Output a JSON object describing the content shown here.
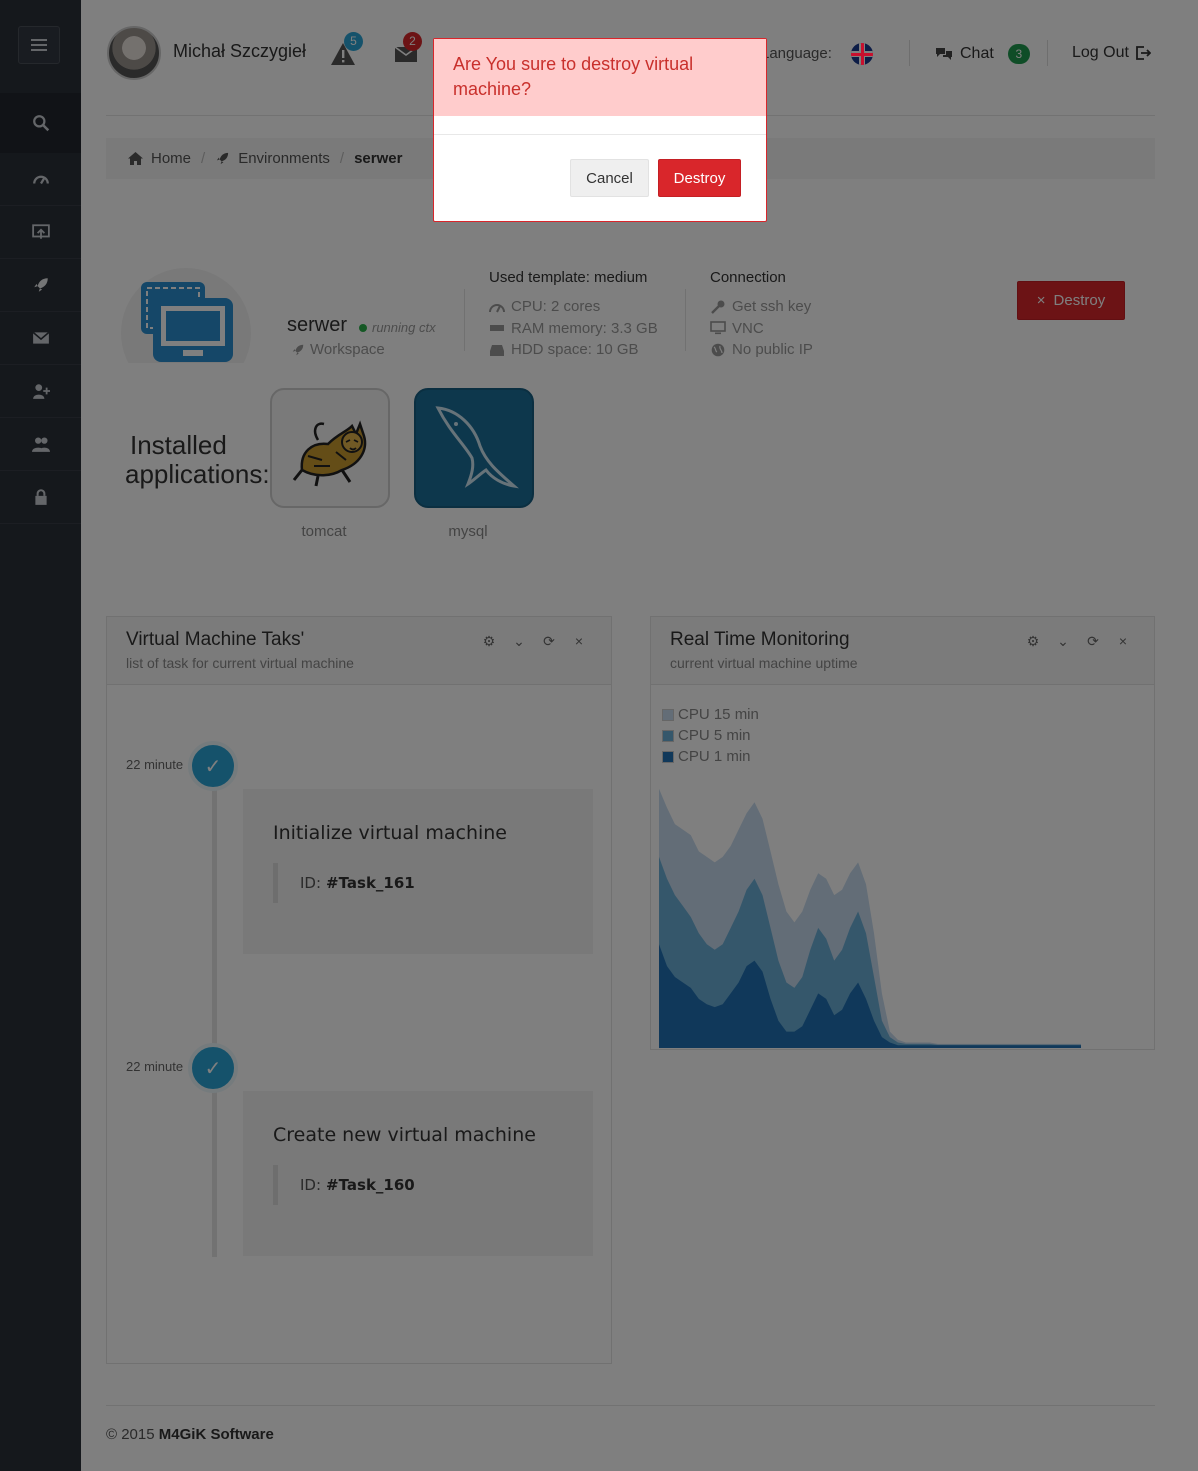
{
  "header": {
    "username": "Michał Szczygieł",
    "alerts_count": "5",
    "messages_count": "2",
    "language_label": "Language:",
    "chat_label": "Chat",
    "chat_count": "3",
    "logout_label": "Log Out"
  },
  "breadcrumb": {
    "home": "Home",
    "environments": "Environments",
    "current": "serwer"
  },
  "vm": {
    "name": "serwer",
    "status": "running ctx",
    "workspace": "Workspace",
    "template_title": "Used template: medium",
    "cpu": "CPU: 2 cores",
    "ram": "RAM memory: 3.3 GB",
    "hdd": "HDD space: 10 GB",
    "connection_title": "Connection",
    "ssh": "Get ssh key",
    "vnc": "VNC",
    "ip": "No public IP",
    "destroy_label": "Destroy"
  },
  "apps": {
    "title_line1": "Installed",
    "title_line2": "applications:",
    "items": [
      {
        "label": "tomcat",
        "icon": "tomcat-icon"
      },
      {
        "label": "mysql",
        "icon": "mysql-icon"
      }
    ]
  },
  "tasks_panel": {
    "title": "Virtual Machine Taks'",
    "subtitle": "list of task for current virtual machine",
    "tasks": [
      {
        "time": "22 minute",
        "title": "Initialize virtual machine",
        "id_label": "ID:",
        "id": "#Task_161"
      },
      {
        "time": "22 minute",
        "title": "Create new virtual machine",
        "id_label": "ID:",
        "id": "#Task_160"
      }
    ]
  },
  "monitor_panel": {
    "title": "Real Time Monitoring",
    "subtitle": "current virtual machine uptime",
    "legend": [
      "CPU 15 min",
      "CPU 5 min",
      "CPU 1 min"
    ]
  },
  "chart_data": {
    "type": "area",
    "series": [
      {
        "name": "CPU 15 min",
        "color": "#c6dbef",
        "values": [
          0.95,
          0.88,
          0.82,
          0.8,
          0.78,
          0.72,
          0.7,
          0.68,
          0.7,
          0.74,
          0.8,
          0.86,
          0.9,
          0.84,
          0.72,
          0.6,
          0.5,
          0.46,
          0.5,
          0.58,
          0.64,
          0.62,
          0.56,
          0.58,
          0.64,
          0.68,
          0.6,
          0.42,
          0.2,
          0.06,
          0.03,
          0.02,
          0.02,
          0.02,
          0.02,
          0.015,
          0.015,
          0.015,
          0.015,
          0.015,
          0.015,
          0.015,
          0.015,
          0.015,
          0.015,
          0.015,
          0.015,
          0.015,
          0.015,
          0.015,
          0.015,
          0.015,
          0.015,
          0.015
        ]
      },
      {
        "name": "CPU 5 min",
        "color": "#6baed6",
        "values": [
          0.7,
          0.62,
          0.56,
          0.52,
          0.48,
          0.42,
          0.38,
          0.36,
          0.38,
          0.44,
          0.5,
          0.58,
          0.62,
          0.56,
          0.44,
          0.32,
          0.24,
          0.22,
          0.26,
          0.36,
          0.44,
          0.4,
          0.32,
          0.36,
          0.44,
          0.5,
          0.42,
          0.26,
          0.1,
          0.04,
          0.02,
          0.015,
          0.015,
          0.015,
          0.015,
          0.012,
          0.012,
          0.012,
          0.012,
          0.012,
          0.012,
          0.012,
          0.012,
          0.012,
          0.012,
          0.012,
          0.012,
          0.012,
          0.012,
          0.012,
          0.012,
          0.012,
          0.012,
          0.012
        ]
      },
      {
        "name": "CPU 1 min",
        "color": "#2171b5",
        "values": [
          0.38,
          0.3,
          0.26,
          0.24,
          0.22,
          0.18,
          0.16,
          0.15,
          0.16,
          0.2,
          0.24,
          0.3,
          0.32,
          0.28,
          0.18,
          0.1,
          0.06,
          0.06,
          0.08,
          0.14,
          0.2,
          0.18,
          0.12,
          0.14,
          0.2,
          0.24,
          0.18,
          0.1,
          0.04,
          0.02,
          0.01,
          0.01,
          0.01,
          0.01,
          0.01,
          0.01,
          0.01,
          0.01,
          0.01,
          0.01,
          0.01,
          0.01,
          0.01,
          0.01,
          0.01,
          0.01,
          0.01,
          0.01,
          0.01,
          0.01,
          0.01,
          0.01,
          0.01,
          0.01
        ]
      }
    ]
  },
  "footer": {
    "copyright": "© 2015",
    "company": "M4GiK Software"
  },
  "modal": {
    "question": "Are You sure to destroy virtual machine?",
    "cancel_label": "Cancel",
    "destroy_label": "Destroy"
  },
  "colors": {
    "sidebar": "#2b3038",
    "danger": "#d9262b",
    "accent": "#2aa5d6",
    "success": "#1f9a4e"
  }
}
